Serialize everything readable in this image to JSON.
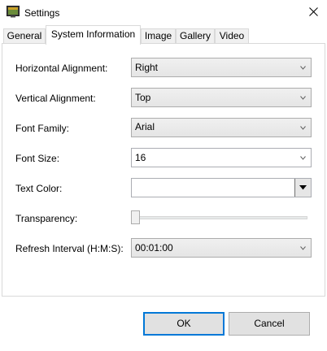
{
  "window": {
    "title": "Settings"
  },
  "icons": {
    "app": "settings-app-icon",
    "close": "close-icon",
    "dropdown": "chevron-down-icon"
  },
  "tabs": [
    {
      "label": "General",
      "active": false
    },
    {
      "label": "System Information",
      "active": true
    },
    {
      "label": "Image",
      "active": false
    },
    {
      "label": "Gallery",
      "active": false
    },
    {
      "label": "Video",
      "active": false
    }
  ],
  "form": {
    "horizontal_alignment": {
      "label": "Horizontal Alignment:",
      "value": "Right"
    },
    "vertical_alignment": {
      "label": "Vertical Alignment:",
      "value": "Top"
    },
    "font_family": {
      "label": "Font Family:",
      "value": "Arial"
    },
    "font_size": {
      "label": "Font Size:",
      "value": "16"
    },
    "text_color": {
      "label": "Text Color:",
      "value": ""
    },
    "transparency": {
      "label": "Transparency:",
      "value": 0
    },
    "refresh_interval": {
      "label": "Refresh Interval (H:M:S):",
      "value": "00:01:00"
    }
  },
  "buttons": {
    "ok": "OK",
    "cancel": "Cancel"
  },
  "colors": {
    "accent": "#0078d7",
    "button_face": "#e1e1e1",
    "border": "#adadad"
  }
}
